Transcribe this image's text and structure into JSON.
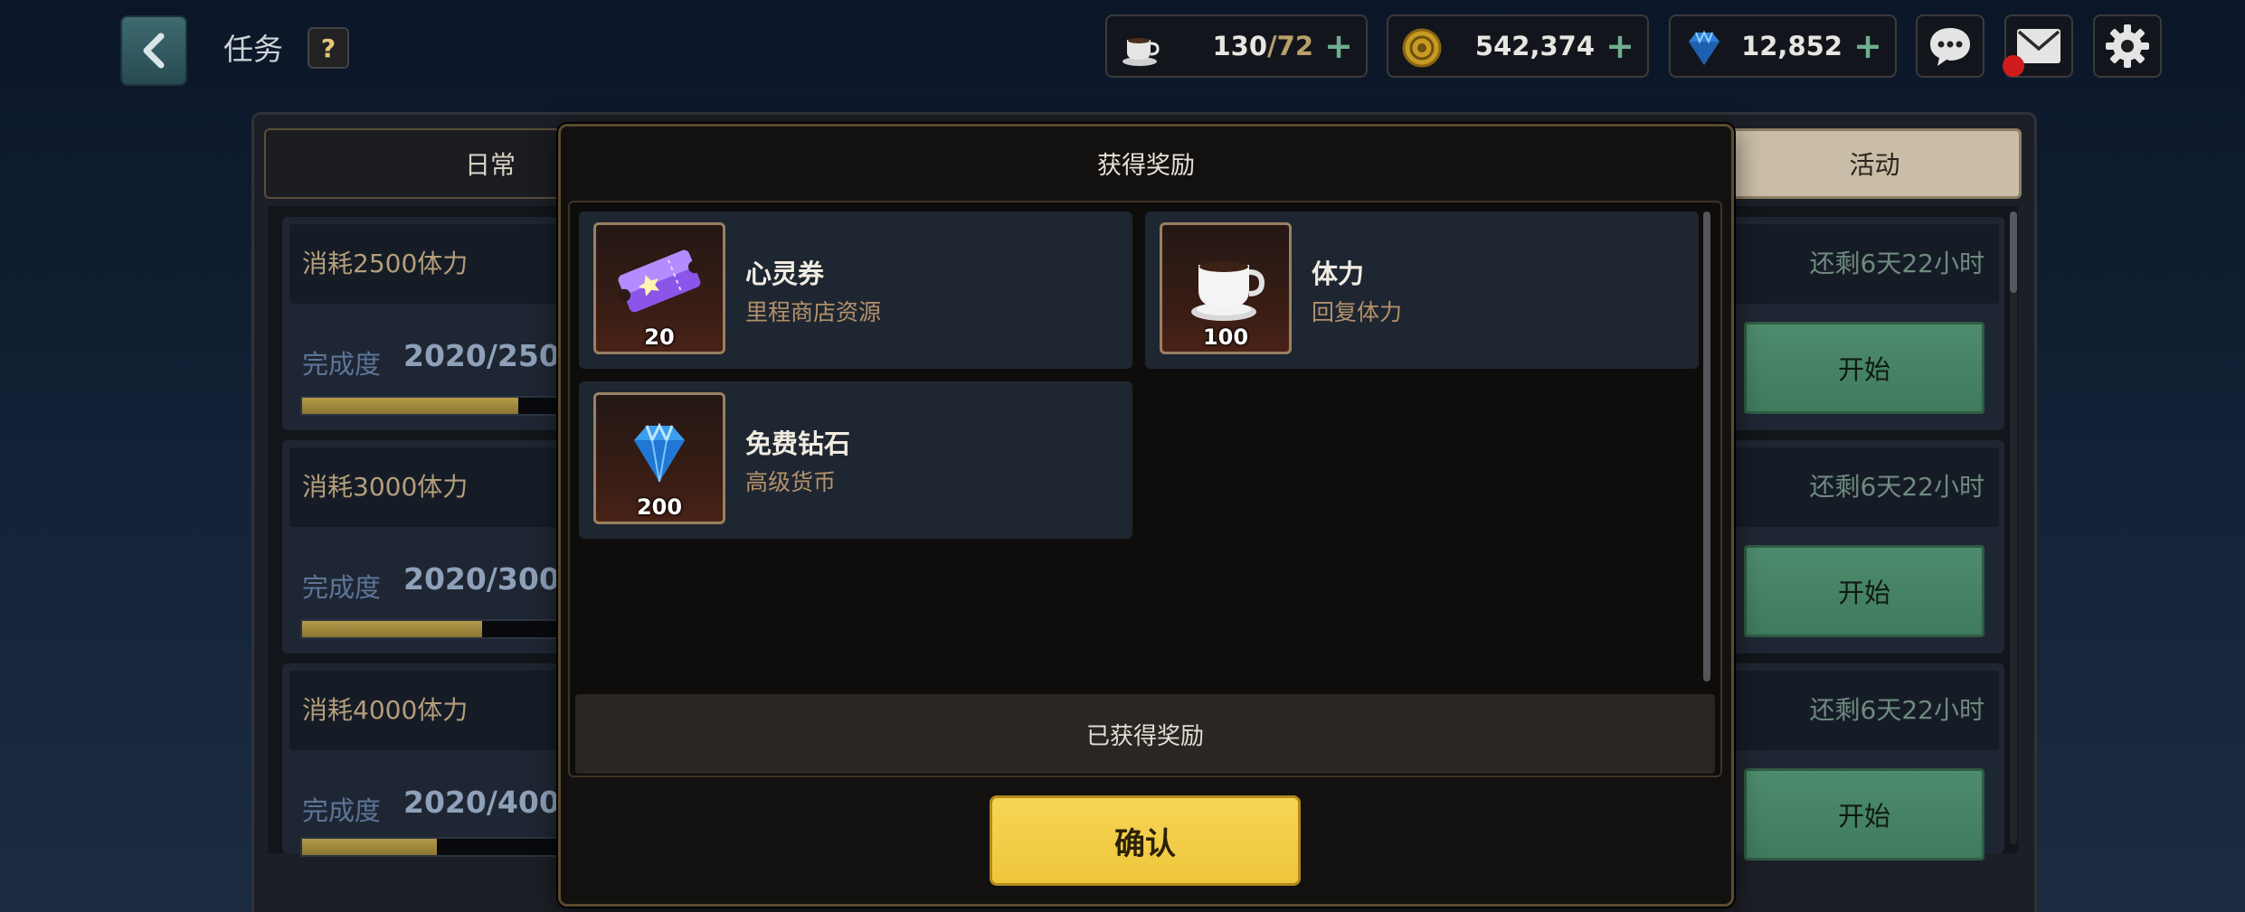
{
  "header": {
    "title": "任务",
    "help_label": "?",
    "resources": [
      {
        "name": "stamina",
        "icon": "coffee-cup-icon",
        "value_main": "130",
        "value_max": "/72",
        "plus": "+"
      },
      {
        "name": "gold",
        "icon": "gold-coin-icon",
        "value": "542,374",
        "plus": "+"
      },
      {
        "name": "diamond",
        "icon": "diamond-icon",
        "value": "12,852",
        "plus": "+"
      }
    ],
    "buttons": [
      "chat-icon",
      "mail-icon",
      "gear-icon"
    ]
  },
  "tabs": {
    "daily": "日常",
    "event": "活动"
  },
  "quests": [
    {
      "title": "消耗2500体力",
      "progress_label": "完成度",
      "progress_value": "2020/250",
      "progress": 0.808,
      "remaining": "还剩6天22小时",
      "button": "开始"
    },
    {
      "title": "消耗3000体力",
      "progress_label": "完成度",
      "progress_value": "2020/300",
      "progress": 0.673,
      "remaining": "还剩6天22小时",
      "button": "开始"
    },
    {
      "title": "消耗4000体力",
      "progress_label": "完成度",
      "progress_value": "2020/400",
      "progress": 0.505,
      "remaining": "还剩6天22小时",
      "button": "开始"
    }
  ],
  "modal": {
    "title": "获得奖励",
    "rewards": [
      {
        "name": "心灵券",
        "desc": "里程商店资源",
        "qty": "20",
        "icon": "ticket-icon"
      },
      {
        "name": "体力",
        "desc": "回复体力",
        "qty": "100",
        "icon": "coffee-cup-icon"
      },
      {
        "name": "免费钻石",
        "desc": "高级货币",
        "qty": "200",
        "icon": "diamond-icon"
      }
    ],
    "obtained_label": "已获得奖励",
    "confirm_label": "确认"
  },
  "colors": {
    "accent_gold": "#f2cf4a",
    "start_green": "#4d8c6c",
    "progress_fill": "#a28c40",
    "mail_badge": "#d01c1c"
  }
}
